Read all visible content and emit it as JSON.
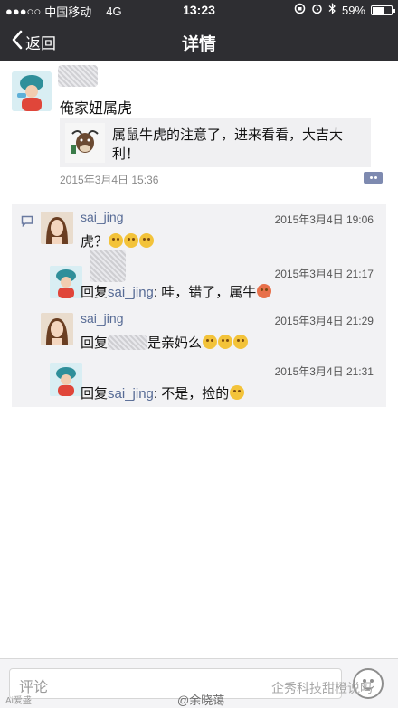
{
  "status_bar": {
    "signal": "●●●○○",
    "carrier": "中国移动",
    "network": "4G",
    "time": "13:23",
    "battery": "59%",
    "battery_level": 0.59
  },
  "nav": {
    "back_label": "返回",
    "title": "详情"
  },
  "post": {
    "text": "俺家妞属虎",
    "shared_link_text": "属鼠牛虎的注意了，进来看看，大吉大利！",
    "time": "2015年3月4日 15:36"
  },
  "comments": [
    {
      "name": "sai_jing",
      "text": "虎？",
      "time": "2015年3月4日 19:06",
      "emoji_count": 3
    },
    {
      "name": "",
      "reply_prefix": "回复",
      "reply_to": "sai_jing",
      "text": ": 哇，错了，属牛",
      "time": "2015年3月4日 21:17",
      "emoji_count": 1
    },
    {
      "name": "sai_jing",
      "reply_prefix": "回复",
      "text": "是亲妈么",
      "time": "2015年3月4日 21:29",
      "emoji_count": 3
    },
    {
      "name": "",
      "reply_prefix": "回复",
      "reply_to": "sai_jing",
      "text": ": 不是，捡的",
      "time": "2015年3月4日 21:31",
      "emoji_count": 1
    }
  ],
  "bottom": {
    "comment_placeholder": "评论"
  },
  "watermarks": {
    "left": "Ai爱盛",
    "center": "@余晓蔼",
    "right": "企秀科技甜橙说吗"
  },
  "colors": {
    "bar": "#2e2e32",
    "link": "#576b95",
    "comment_bg": "#f2f2f4"
  }
}
